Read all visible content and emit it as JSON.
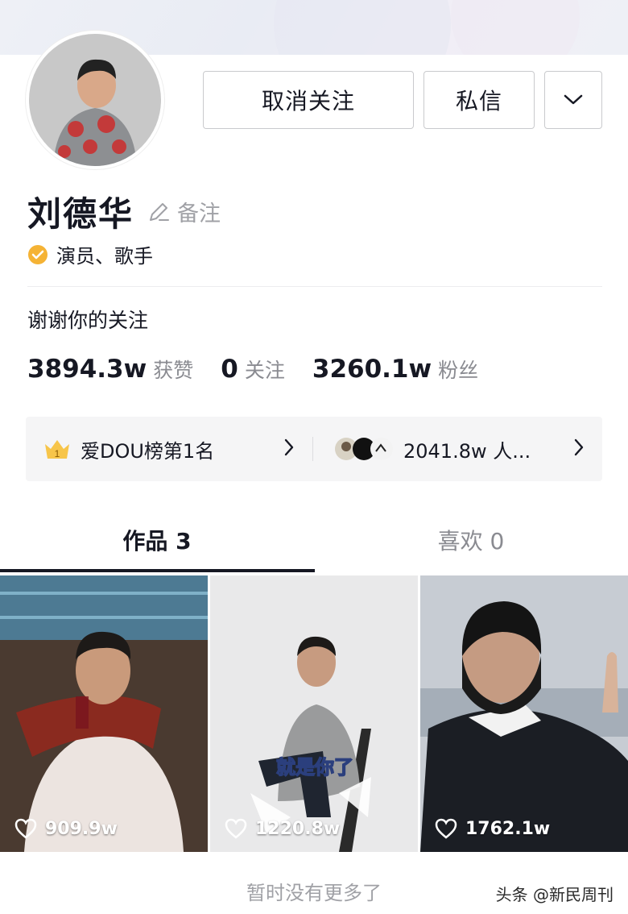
{
  "profile": {
    "name": "刘德华",
    "remark_label": "备注",
    "verified_title": "演员、歌手",
    "bio": "谢谢你的关注"
  },
  "actions": {
    "unfollow_label": "取消关注",
    "message_label": "私信",
    "more_icon": "chevron-down-icon"
  },
  "stats": [
    {
      "value": "3894.3w",
      "label": "获赞"
    },
    {
      "value": "0",
      "label": "关注"
    },
    {
      "value": "3260.1w",
      "label": "粉丝"
    }
  ],
  "ranking": {
    "rank_text": "爱DOU榜第1名",
    "crown_number": "1",
    "fans_text": "2041.8w 人..."
  },
  "tabs": [
    {
      "label": "作品 3",
      "active": true
    },
    {
      "label": "喜欢 0",
      "active": false
    }
  ],
  "videos": [
    {
      "likes": "909.9w"
    },
    {
      "likes": "1220.8w",
      "caption": "就是你了"
    },
    {
      "likes": "1762.1w"
    }
  ],
  "footer": {
    "no_more": "暂时没有更多了",
    "watermark": "头条 @新民周刊"
  },
  "colors": {
    "verified_badge": "#f5b335",
    "text_primary": "#161823",
    "text_secondary": "#8a8b91"
  }
}
